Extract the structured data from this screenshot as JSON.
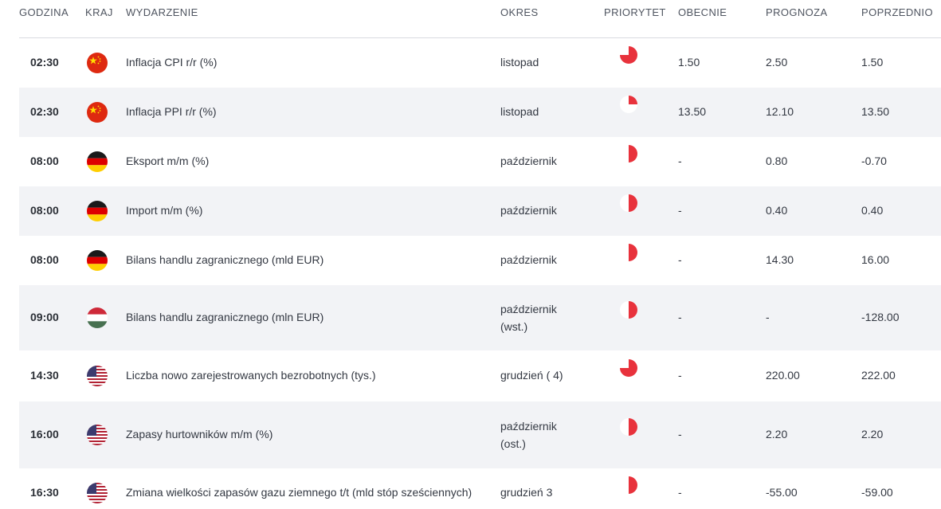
{
  "table": {
    "headers": {
      "time": "GODZINA",
      "country": "KRAJ",
      "event": "WYDARZENIE",
      "period": "OKRES",
      "priority": "PRIORYTET",
      "actual": "OBECNIE",
      "forecast": "PROGNOZA",
      "previous": "POPRZEDNIO"
    },
    "accent_color": "#e8323c",
    "rows": [
      {
        "time": "02:30",
        "country_icon": "china-flag-icon",
        "event": "Inflacja CPI r/r (%)",
        "period": "listopad",
        "period2": "",
        "priority": "high",
        "actual": "1.50",
        "forecast": "2.50",
        "previous": "1.50"
      },
      {
        "time": "02:30",
        "country_icon": "china-flag-icon",
        "event": "Inflacja PPI r/r (%)",
        "period": "listopad",
        "period2": "",
        "priority": "low",
        "actual": "13.50",
        "forecast": "12.10",
        "previous": "13.50"
      },
      {
        "time": "08:00",
        "country_icon": "germany-flag-icon",
        "event": "Eksport m/m (%)",
        "period": "październik",
        "period2": "",
        "priority": "medium",
        "actual": "-",
        "forecast": "0.80",
        "previous": "-0.70"
      },
      {
        "time": "08:00",
        "country_icon": "germany-flag-icon",
        "event": "Import m/m (%)",
        "period": "październik",
        "period2": "",
        "priority": "medium",
        "actual": "-",
        "forecast": "0.40",
        "previous": "0.40"
      },
      {
        "time": "08:00",
        "country_icon": "germany-flag-icon",
        "event": "Bilans handlu zagranicznego (mld EUR)",
        "period": "październik",
        "period2": "",
        "priority": "medium",
        "actual": "-",
        "forecast": "14.30",
        "previous": "16.00"
      },
      {
        "time": "09:00",
        "country_icon": "hungary-flag-icon",
        "event": "Bilans handlu zagranicznego (mln EUR)",
        "period": "październik",
        "period2": "(wst.)",
        "priority": "medium",
        "actual": "-",
        "forecast": "-",
        "previous": "-128.00"
      },
      {
        "time": "14:30",
        "country_icon": "usa-flag-icon",
        "event": "Liczba nowo zarejestrowanych bezrobotnych (tys.)",
        "period": "grudzień ( 4)",
        "period2": "",
        "priority": "high",
        "actual": "-",
        "forecast": "220.00",
        "previous": "222.00"
      },
      {
        "time": "16:00",
        "country_icon": "usa-flag-icon",
        "event": "Zapasy hurtowników m/m (%)",
        "period": "październik",
        "period2": "(ost.)",
        "priority": "medium",
        "actual": "-",
        "forecast": "2.20",
        "previous": "2.20"
      },
      {
        "time": "16:30",
        "country_icon": "usa-flag-icon",
        "event": "Zmiana wielkości zapasów gazu ziemnego t/t (mld stóp sześciennych)",
        "period": "grudzień 3",
        "period2": "",
        "priority": "medium",
        "actual": "-",
        "forecast": "-55.00",
        "previous": "-59.00"
      }
    ]
  }
}
